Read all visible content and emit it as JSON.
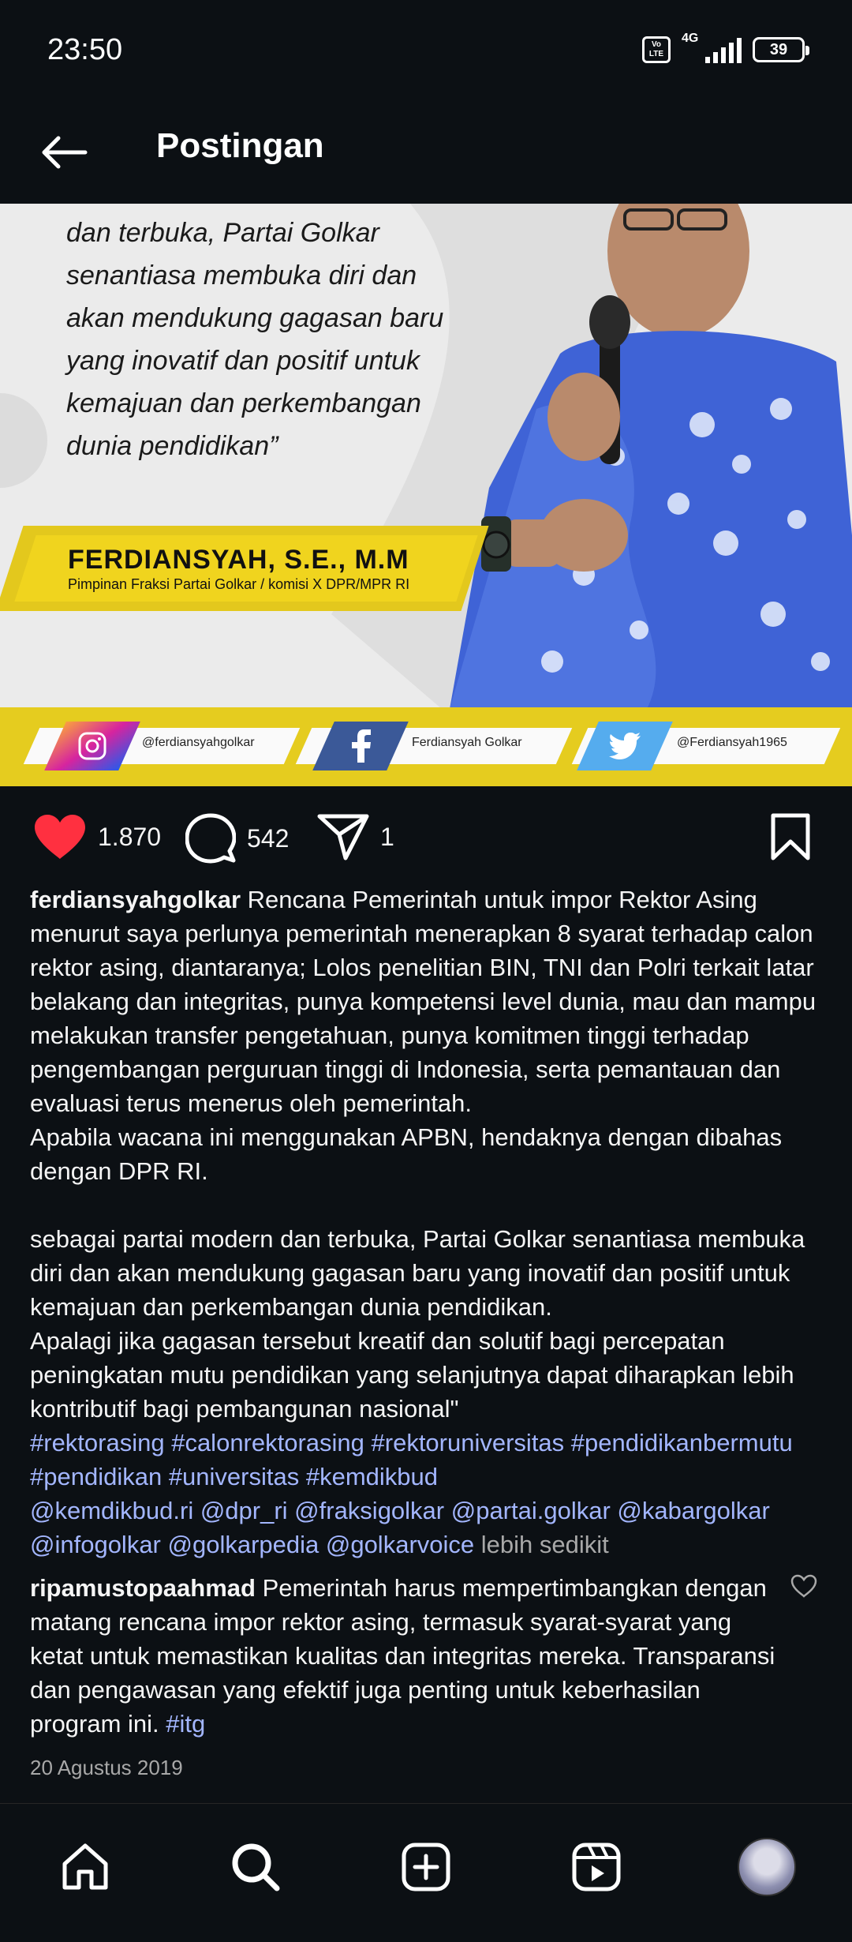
{
  "status_bar": {
    "time": "23:50",
    "volte": "Vo\nLTE",
    "network": "4G",
    "battery": "39"
  },
  "header": {
    "title": "Postingan",
    "back_icon": "arrow-left-icon"
  },
  "post_image": {
    "quote": "dan terbuka, Partai Golkar\nsenantiasa membuka diri dan\nakan mendukung gagasan baru\nyang inovatif dan positif untuk\nkemajuan dan perkembangan\ndunia pendidikan”",
    "person_name": "FERDIANSYAH, S.E., M.M",
    "person_title": "Pimpinan Fraksi Partai Golkar / komisi X DPR/MPR RI",
    "socials": [
      {
        "platform": "instagram",
        "icon": "instagram-icon",
        "handle": "@ferdiansyahgolkar",
        "color": "#c13584"
      },
      {
        "platform": "facebook",
        "icon": "facebook-icon",
        "handle": "Ferdiansyah Golkar",
        "color": "#3b5998"
      },
      {
        "platform": "twitter",
        "icon": "twitter-icon",
        "handle": "@Ferdiansyah1965",
        "color": "#55acee"
      }
    ]
  },
  "actions": {
    "likes": "1.870",
    "comments": "542",
    "shares": "1",
    "like_color": "#ff3040"
  },
  "caption": {
    "username": "ferdiansyahgolkar",
    "text": " Rencana Pemerintah untuk impor Rektor Asing menurut saya perlunya pemerintah menerapkan 8 syarat terhadap calon rektor asing, diantaranya; Lolos penelitian BIN, TNI dan Polri terkait latar belakang dan integritas, punya kompetensi level dunia, mau dan mampu melakukan transfer pengetahuan, punya komitmen tinggi terhadap pengembangan perguruan tinggi di Indonesia, serta  pemantauan dan evaluasi terus menerus oleh pemerintah.\nApabila wacana ini menggunakan APBN, hendaknya dengan dibahas dengan DPR RI.\n\nsebagai partai modern dan terbuka, Partai Golkar senantiasa membuka diri dan akan mendukung gagasan baru yang inovatif dan positif untuk kemajuan dan perkembangan dunia pendidikan.\nApalagi jika gagasan tersebut kreatif dan solutif bagi percepatan peningkatan mutu pendidikan yang selanjutnya dapat diharapkan lebih kontributif bagi pembangunan nasional\"\n",
    "hashtags": "#rektorasing #calonrektorasing #rektoruniversitas #pendidikanbermutu #pendidikan #universitas #kemdikbud\n@kemdikbud.ri @dpr_ri @fraksigolkar @partai.golkar @kabargolkar @infogolkar @golkarpedia @golkarvoice",
    "more": " lebih sedikit"
  },
  "comment": {
    "username": "ripamustopaahmad",
    "text": " Pemerintah harus mempertimbangkan dengan matang rencana impor rektor asing, termasuk syarat-syarat yang ketat untuk memastikan kualitas dan integritas mereka. Transparansi dan pengawasan yang efektif juga penting untuk keberhasilan program ini. ",
    "tag": "#itg"
  },
  "date": "20 Agustus 2019",
  "bottom_nav": {
    "items": [
      "home-icon",
      "search-icon",
      "create-post-icon",
      "reels-icon",
      "profile-avatar"
    ]
  }
}
